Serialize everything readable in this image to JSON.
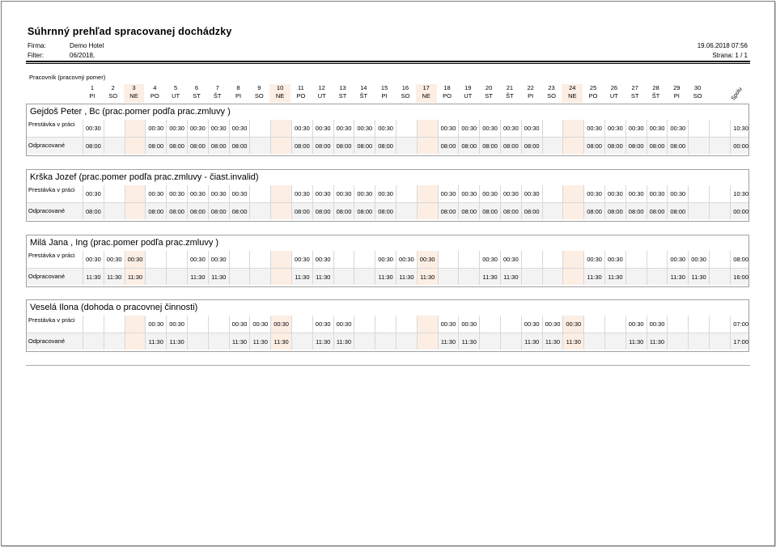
{
  "report": {
    "title": "Súhrnný prehľad spracovanej dochádzky",
    "firma_label": "Firma:",
    "firma_value": "Demo Hotel",
    "filter_label": "Filter:",
    "filter_value": "06/2018,",
    "datetime": "19.06.2018 07:56",
    "page": "Strana: 1 / 1",
    "column_caption": "Pracovník (pracovný pomer)",
    "sum_header": "Spolu"
  },
  "days": [
    {
      "d": "1",
      "w": "PI"
    },
    {
      "d": "2",
      "w": "SO"
    },
    {
      "d": "3",
      "w": "NE",
      "ne": true
    },
    {
      "d": "4",
      "w": "PO"
    },
    {
      "d": "5",
      "w": "UT"
    },
    {
      "d": "6",
      "w": "ST"
    },
    {
      "d": "7",
      "w": "ŠT"
    },
    {
      "d": "8",
      "w": "PI"
    },
    {
      "d": "9",
      "w": "SO"
    },
    {
      "d": "10",
      "w": "NE",
      "ne": true
    },
    {
      "d": "11",
      "w": "PO"
    },
    {
      "d": "12",
      "w": "UT"
    },
    {
      "d": "13",
      "w": "ST"
    },
    {
      "d": "14",
      "w": "ŠT"
    },
    {
      "d": "15",
      "w": "PI"
    },
    {
      "d": "16",
      "w": "SO"
    },
    {
      "d": "17",
      "w": "NE",
      "ne": true
    },
    {
      "d": "18",
      "w": "PO"
    },
    {
      "d": "19",
      "w": "UT"
    },
    {
      "d": "20",
      "w": "ST"
    },
    {
      "d": "21",
      "w": "ŠT"
    },
    {
      "d": "22",
      "w": "PI"
    },
    {
      "d": "23",
      "w": "SO"
    },
    {
      "d": "24",
      "w": "NE",
      "ne": true
    },
    {
      "d": "25",
      "w": "PO"
    },
    {
      "d": "26",
      "w": "UT"
    },
    {
      "d": "27",
      "w": "ST"
    },
    {
      "d": "28",
      "w": "ŠT"
    },
    {
      "d": "29",
      "w": "PI"
    },
    {
      "d": "30",
      "w": "SO"
    }
  ],
  "row_labels": {
    "break": "Prestávka v práci",
    "worked": "Odpracované"
  },
  "employees": [
    {
      "name": "Gejdoš Peter , Bc (prac.pomer podľa prac.zmluvy )",
      "break": [
        "00:30",
        "",
        "",
        "00:30",
        "00:30",
        "00:30",
        "00:30",
        "00:30",
        "",
        "",
        "00:30",
        "00:30",
        "00:30",
        "00:30",
        "00:30",
        "",
        "",
        "00:30",
        "00:30",
        "00:30",
        "00:30",
        "00:30",
        "",
        "",
        "00:30",
        "00:30",
        "00:30",
        "00:30",
        "00:30",
        ""
      ],
      "break_sum": "10:30",
      "worked": [
        "08:00",
        "",
        "",
        "08:00",
        "08:00",
        "08:00",
        "08:00",
        "08:00",
        "",
        "",
        "08:00",
        "08:00",
        "08:00",
        "08:00",
        "08:00",
        "",
        "",
        "08:00",
        "08:00",
        "08:00",
        "08:00",
        "08:00",
        "",
        "",
        "08:00",
        "08:00",
        "08:00",
        "08:00",
        "08:00",
        ""
      ],
      "worked_sum": "00:00"
    },
    {
      "name": "Krška Jozef  (prac.pomer podľa prac.zmluvy - čiast.invalid)",
      "break": [
        "00:30",
        "",
        "",
        "00:30",
        "00:30",
        "00:30",
        "00:30",
        "00:30",
        "",
        "",
        "00:30",
        "00:30",
        "00:30",
        "00:30",
        "00:30",
        "",
        "",
        "00:30",
        "00:30",
        "00:30",
        "00:30",
        "00:30",
        "",
        "",
        "00:30",
        "00:30",
        "00:30",
        "00:30",
        "00:30",
        ""
      ],
      "break_sum": "10:30",
      "worked": [
        "08:00",
        "",
        "",
        "08:00",
        "08:00",
        "08:00",
        "08:00",
        "08:00",
        "",
        "",
        "08:00",
        "08:00",
        "08:00",
        "08:00",
        "08:00",
        "",
        "",
        "08:00",
        "08:00",
        "08:00",
        "08:00",
        "08:00",
        "",
        "",
        "08:00",
        "08:00",
        "08:00",
        "08:00",
        "08:00",
        ""
      ],
      "worked_sum": "00:00"
    },
    {
      "name": "Milá Jana , Ing (prac.pomer podľa prac.zmluvy )",
      "break": [
        "00:30",
        "00:30",
        "00:30",
        "",
        "",
        "00:30",
        "00:30",
        "",
        "",
        "",
        "00:30",
        "00:30",
        "",
        "",
        "00:30",
        "00:30",
        "00:30",
        "",
        "",
        "00:30",
        "00:30",
        "",
        "",
        "",
        "00:30",
        "00:30",
        "",
        "",
        "00:30",
        "00:30"
      ],
      "break_sum": "08:00",
      "worked": [
        "11:30",
        "11:30",
        "11:30",
        "",
        "",
        "11:30",
        "11:30",
        "",
        "",
        "",
        "11:30",
        "11:30",
        "",
        "",
        "11:30",
        "11:30",
        "11:30",
        "",
        "",
        "11:30",
        "11:30",
        "",
        "",
        "",
        "11:30",
        "11:30",
        "",
        "",
        "11:30",
        "11:30"
      ],
      "worked_sum": "16:00"
    },
    {
      "name": "Veselá Ilona  (dohoda o pracovnej činnosti)",
      "break": [
        "",
        "",
        "",
        "00:30",
        "00:30",
        "",
        "",
        "00:30",
        "00:30",
        "00:30",
        "",
        "00:30",
        "00:30",
        "",
        "",
        "",
        "",
        "00:30",
        "00:30",
        "",
        "",
        "00:30",
        "00:30",
        "00:30",
        "",
        "",
        "00:30",
        "00:30",
        "",
        ""
      ],
      "break_sum": "07:00",
      "worked": [
        "",
        "",
        "",
        "11:30",
        "11:30",
        "",
        "",
        "11:30",
        "11:30",
        "11:30",
        "",
        "11:30",
        "11:30",
        "",
        "",
        "",
        "",
        "11:30",
        "11:30",
        "",
        "",
        "11:30",
        "11:30",
        "11:30",
        "",
        "",
        "11:30",
        "11:30",
        "",
        ""
      ],
      "worked_sum": "17:00"
    }
  ]
}
